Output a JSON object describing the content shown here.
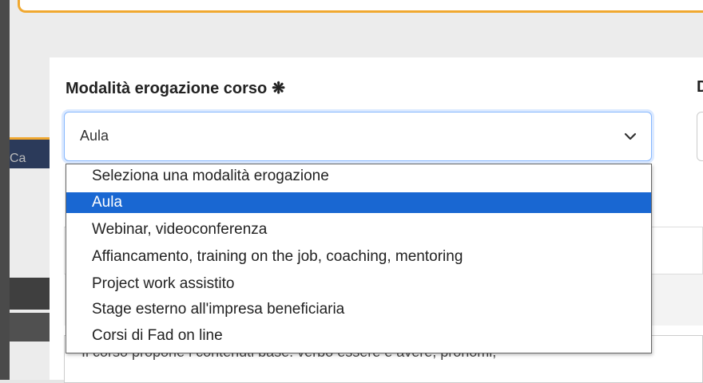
{
  "form": {
    "field_label": "Modalità erogazione corso",
    "required_mark": "❋",
    "next_field_label": "D",
    "select": {
      "selected_value": "Aula",
      "options": [
        "Seleziona una modalità erogazione",
        "Aula",
        "Webinar, videoconferenza",
        "Affiancamento, training on the job, coaching, mentoring",
        "Project work assistito",
        "Stage esterno all'impresa beneficiaria",
        "Corsi di Fad on line"
      ],
      "highlighted_index": 1
    },
    "description_text": "Il corso propone i contenuti base: verbo essere e avere, pronomi,"
  },
  "background": {
    "partial_nav_text": "Ca"
  },
  "colors": {
    "accent": "#f0a830",
    "highlight": "#1967d2",
    "focus_border": "#86b7fe"
  }
}
